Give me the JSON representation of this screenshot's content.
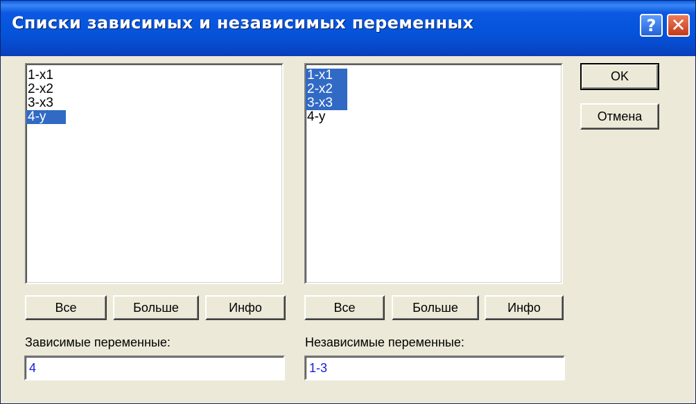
{
  "window": {
    "title": "Списки зависимых и независимых переменных",
    "help_label": "?",
    "close_label": "✕"
  },
  "left_list": {
    "items": [
      {
        "label": "1-x1",
        "selected": false
      },
      {
        "label": "2-x2",
        "selected": false
      },
      {
        "label": "3-x3",
        "selected": false
      },
      {
        "label": "4-y",
        "selected": true
      }
    ],
    "buttons": {
      "all": "Все",
      "more": "Больше",
      "info": "Инфо"
    },
    "field_label": "Зависимые переменные:",
    "field_value": "4"
  },
  "right_list": {
    "items": [
      {
        "label": "1-x1",
        "selected": true
      },
      {
        "label": "2-x2",
        "selected": true
      },
      {
        "label": "3-x3",
        "selected": true
      },
      {
        "label": "4-y",
        "selected": false
      }
    ],
    "buttons": {
      "all": "Все",
      "more": "Больше",
      "info": "Инфо"
    },
    "field_label": "Независимые переменные:",
    "field_value": "1-3"
  },
  "actions": {
    "ok": "OK",
    "cancel": "Отмена"
  },
  "colors": {
    "selection": "#316ac5",
    "titlebar": "#0553d9",
    "dialog_bg": "#ece9d8",
    "field_text": "#1b1bdb"
  }
}
